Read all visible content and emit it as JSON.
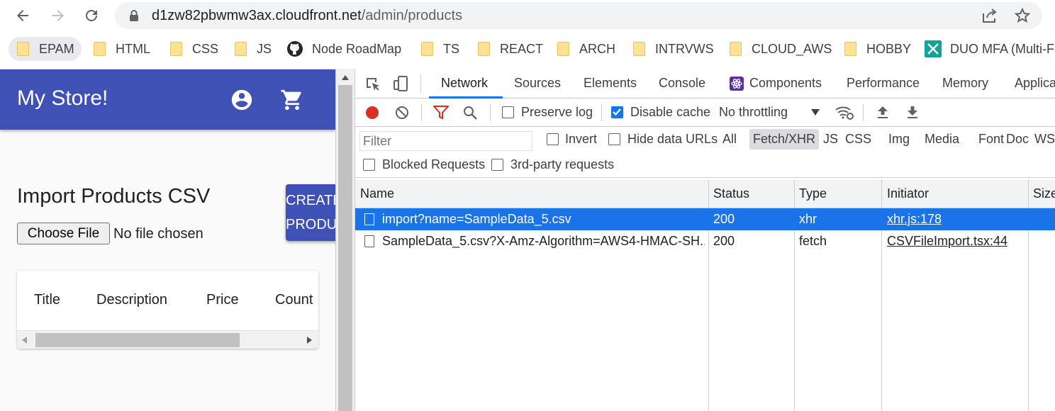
{
  "browser": {
    "url_host": "d1zw82pbwmw3ax.cloudfront.net",
    "url_path": "/admin/products",
    "bookmarks": [
      "EPAM",
      "HTML",
      "CSS",
      "JS",
      "Node RoadMap",
      "TS",
      "REACT",
      "ARCH",
      "INTRVWS",
      "CLOUD_AWS",
      "HOBBY",
      "DUO MFA (Multi-Fa"
    ]
  },
  "app": {
    "title": "My Store!",
    "import_title": "Import Products CSV",
    "choose_file_label": "Choose File",
    "no_file_text": "No file chosen",
    "create_button_line1": "CREATE",
    "create_button_line2": "PRODU",
    "table_headers": [
      "Title",
      "Description",
      "Price",
      "Count"
    ]
  },
  "devtools": {
    "tabs": [
      "Network",
      "Sources",
      "Elements",
      "Console",
      "Components",
      "Performance",
      "Memory",
      "Applica"
    ],
    "active_tab": "Network",
    "toolbar": {
      "preserve_log": "Preserve log",
      "preserve_log_checked": false,
      "disable_cache": "Disable cache",
      "disable_cache_checked": true,
      "throttling": "No throttling"
    },
    "filter": {
      "placeholder": "Filter",
      "invert": "Invert",
      "hide_data_urls": "Hide data URLs",
      "types": [
        "All",
        "Fetch/XHR",
        "JS",
        "CSS",
        "Img",
        "Media",
        "Font",
        "Doc",
        "WS"
      ],
      "active_type": "Fetch/XHR",
      "blocked_requests": "Blocked Requests",
      "third_party": "3rd-party requests"
    },
    "columns": [
      "Name",
      "Status",
      "Type",
      "Initiator",
      "Size"
    ],
    "requests": [
      {
        "name": "import?name=SampleData_5.csv",
        "status": "200",
        "type": "xhr",
        "initiator": "xhr.js:178",
        "selected": true
      },
      {
        "name": "SampleData_5.csv?X-Amz-Algorithm=AWS4-HMAC-SH...",
        "status": "200",
        "type": "fetch",
        "initiator": "CSVFileImport.tsx:44",
        "selected": false
      }
    ],
    "colors": {
      "accent": "#1a73e8",
      "record": "#d93025",
      "filter_icon": "#d93025"
    }
  }
}
